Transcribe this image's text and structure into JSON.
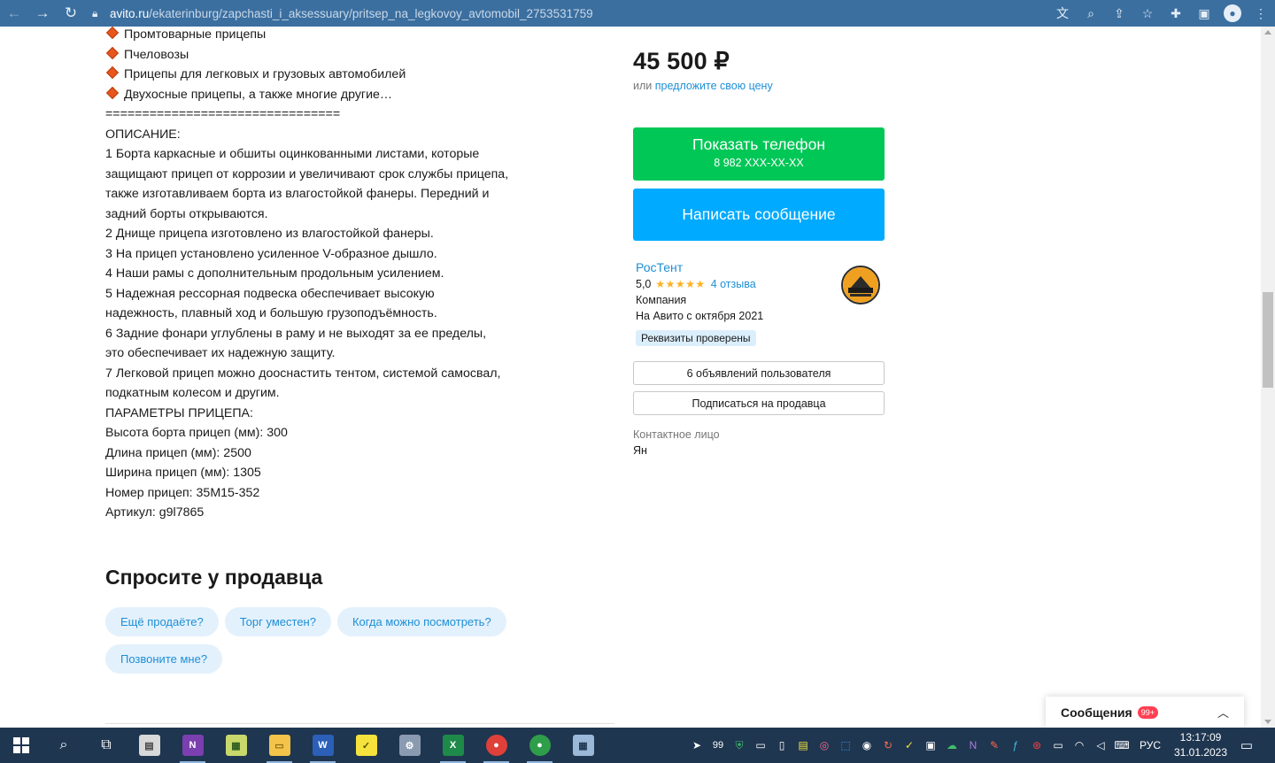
{
  "browser": {
    "url_host": "avito.ru",
    "url_path": "/ekaterinburg/zapchasti_i_aksessuary/pritsep_na_legkovoy_avtomobil_2753531759"
  },
  "description": {
    "bullets": [
      "Промтоварные прицепы",
      "Пчеловозы",
      "Прицепы для легковых и грузовых автомобилей",
      "Двухосные прицепы, а также многие другие…"
    ],
    "lines": [
      "================================",
      "ОПИСАНИЕ:",
      "1 Борта каркасные и обшиты оцинкованными листами, которые",
      "защищают прицеп от коррозии и увеличивают срок службы прицепа,",
      "также изготавливаем борта из влагостойкой фанеры. Передний и",
      "задний борты открываются.",
      "2 Днище прицепа изготовлено из влагостойкой фанеры.",
      "3 На прицеп установлено усиленное V-образное дышло.",
      "4 Наши рамы с дополнительным продольным усилением.",
      "5 Надежная рессорная подвеска обеспечивает высокую",
      "надежность, плавный ход и большую грузоподъёмность.",
      "6 Задние фонари углублены в раму и не выходят за ее пределы,",
      "это обеспечивает их надежную защиту.",
      "7 Легковой прицеп можно дооснастить тентом, системой самосвал,",
      "подкатным колесом и другим.",
      "ПАРАМЕТРЫ ПРИЦЕПА:",
      "Высота борта прицеп (мм): 300",
      "Длина прицеп (мм): 2500",
      "Ширина прицеп (мм): 1305",
      "Номер прицеп: 35М15-352",
      "Артикул: g9l7865"
    ]
  },
  "ask": {
    "title": "Спросите у продавца",
    "chips": [
      "Ещё продаёте?",
      "Торг уместен?",
      "Когда можно посмотреть?",
      "Позвоните мне?"
    ]
  },
  "offer": {
    "price": "45 500 ₽",
    "price_or": "или",
    "price_offer_link": "предложите свою цену",
    "phone_button": "Показать телефон",
    "phone_masked": "8 982 XXX-XX-XX",
    "message_button": "Написать сообщение"
  },
  "seller": {
    "name": "РосТент",
    "rating": "5,0",
    "stars": "★★★★★",
    "reviews": "4 отзыва",
    "type": "Компания",
    "since": "На Авито с октября 2021",
    "verified": "Реквизиты проверены",
    "ads_button": "6 объявлений пользователя",
    "subscribe_button": "Подписаться на продавца",
    "contact_label": "Контактное лицо",
    "contact_name": "Ян"
  },
  "messages": {
    "label": "Сообщения",
    "badge": "99+"
  },
  "taskbar": {
    "tray_badge": "99",
    "language": "РУС",
    "time": "13:17:09",
    "date": "31.01.2023"
  },
  "colors": {
    "phone_green": "#00c756",
    "message_blue": "#00aaff",
    "link_blue": "#1e8fd6",
    "browser_bar": "#3b6fa0",
    "taskbar": "#1f3650"
  }
}
